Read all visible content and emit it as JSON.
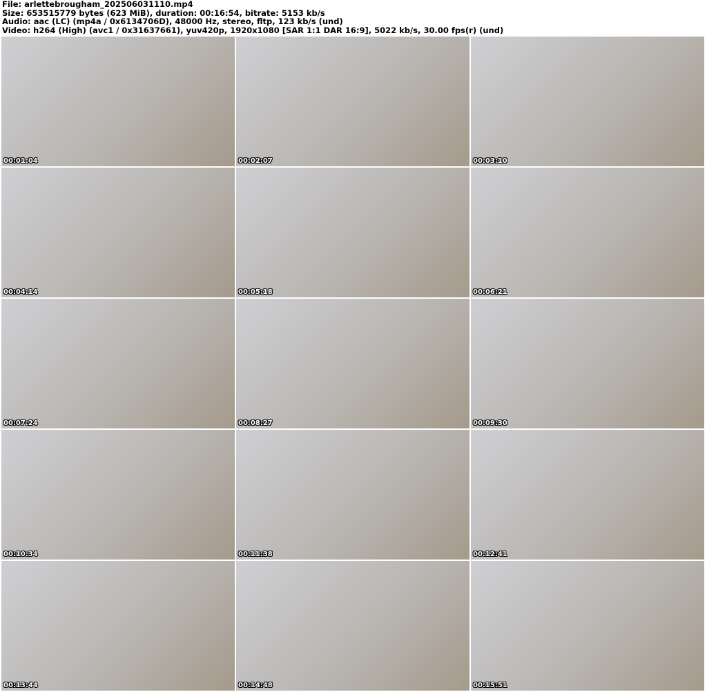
{
  "header": {
    "file": "File: arlettebrougham_202506031110.mp4",
    "size": "Size: 653515779 bytes (623 MiB), duration: 00:16:54, bitrate: 5153 kb/s",
    "audio": "Audio: aac (LC) (mp4a / 0x6134706D), 48000 Hz, stereo, fltp, 123 kb/s (und)",
    "video": "Video: h264 (High) (avc1 / 0x31637661), yuv420p, 1920x1080 [SAR 1:1 DAR 16:9], 5022 kb/s, 30.00 fps(r) (und)"
  },
  "thumbnails": [
    "00:01:04",
    "00:02:07",
    "00:03:10",
    "00:04:14",
    "00:05:18",
    "00:06:21",
    "00:07:24",
    "00:08:27",
    "00:09:30",
    "00:10:34",
    "00:11:38",
    "00:12:41",
    "00:13:44",
    "00:14:48",
    "00:15:51"
  ]
}
